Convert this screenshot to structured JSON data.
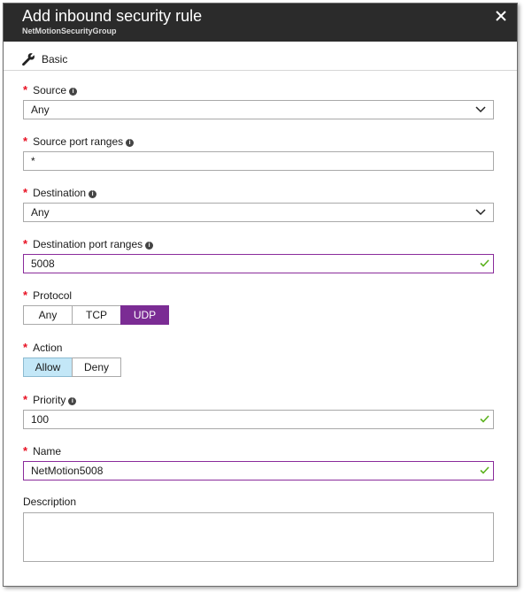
{
  "header": {
    "title": "Add inbound security rule",
    "subtitle": "NetMotionSecurityGroup"
  },
  "toolbar": {
    "basic_label": "Basic"
  },
  "fields": {
    "source": {
      "label": "Source",
      "value": "Any"
    },
    "source_port_ranges": {
      "label": "Source port ranges",
      "value": "*"
    },
    "destination": {
      "label": "Destination",
      "value": "Any"
    },
    "destination_port_ranges": {
      "label": "Destination port ranges",
      "value": "5008"
    },
    "protocol": {
      "label": "Protocol",
      "options": [
        "Any",
        "TCP",
        "UDP"
      ],
      "selected": "UDP"
    },
    "action": {
      "label": "Action",
      "options": [
        "Allow",
        "Deny"
      ],
      "selected": "Allow"
    },
    "priority": {
      "label": "Priority",
      "value": "100"
    },
    "name": {
      "label": "Name",
      "value": "NetMotion5008"
    },
    "description": {
      "label": "Description",
      "value": ""
    }
  },
  "colors": {
    "titlebar": "#2b2b2b",
    "required": "#e81123",
    "accent_purple": "#7b2c94",
    "selected_blue": "#c3e7f7",
    "valid_check": "#5bb21d"
  },
  "icons": {
    "close": "close-icon",
    "wrench": "wrench-icon",
    "info": "info-icon",
    "chevron": "chevron-down-icon",
    "check": "check-icon"
  }
}
